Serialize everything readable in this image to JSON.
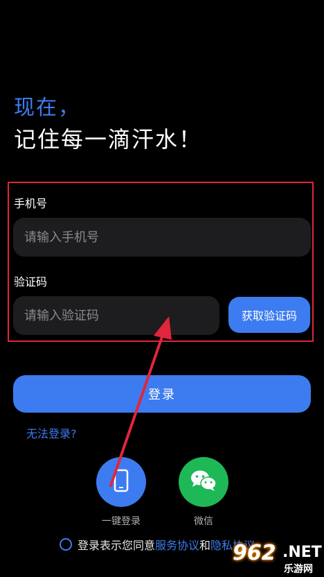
{
  "header": {
    "line1": "现在，",
    "line2": "记住每一滴汗水！"
  },
  "form": {
    "phone_label": "手机号",
    "phone_placeholder": "请输入手机号",
    "code_label": "验证码",
    "code_placeholder": "请输入验证码",
    "get_code_label": "获取验证码"
  },
  "login_button_label": "登录",
  "cannot_login_link": "无法登录?",
  "alt_login": {
    "onekey_label": "一键登录",
    "wechat_label": "微信"
  },
  "agreement": {
    "prefix": "登录表示您同意",
    "service_link": "服务协议",
    "and": "和",
    "privacy_link": "隐私协议"
  },
  "watermark": {
    "number": "962",
    "domain": ".NET",
    "sub": "乐游网"
  },
  "colors": {
    "accent": "#3d7cf0",
    "wechat": "#1fb856",
    "annotation_red": "#e0263a",
    "background": "#000000"
  },
  "icons": {
    "onekey": "phone-icon",
    "wechat": "wechat-icon"
  }
}
